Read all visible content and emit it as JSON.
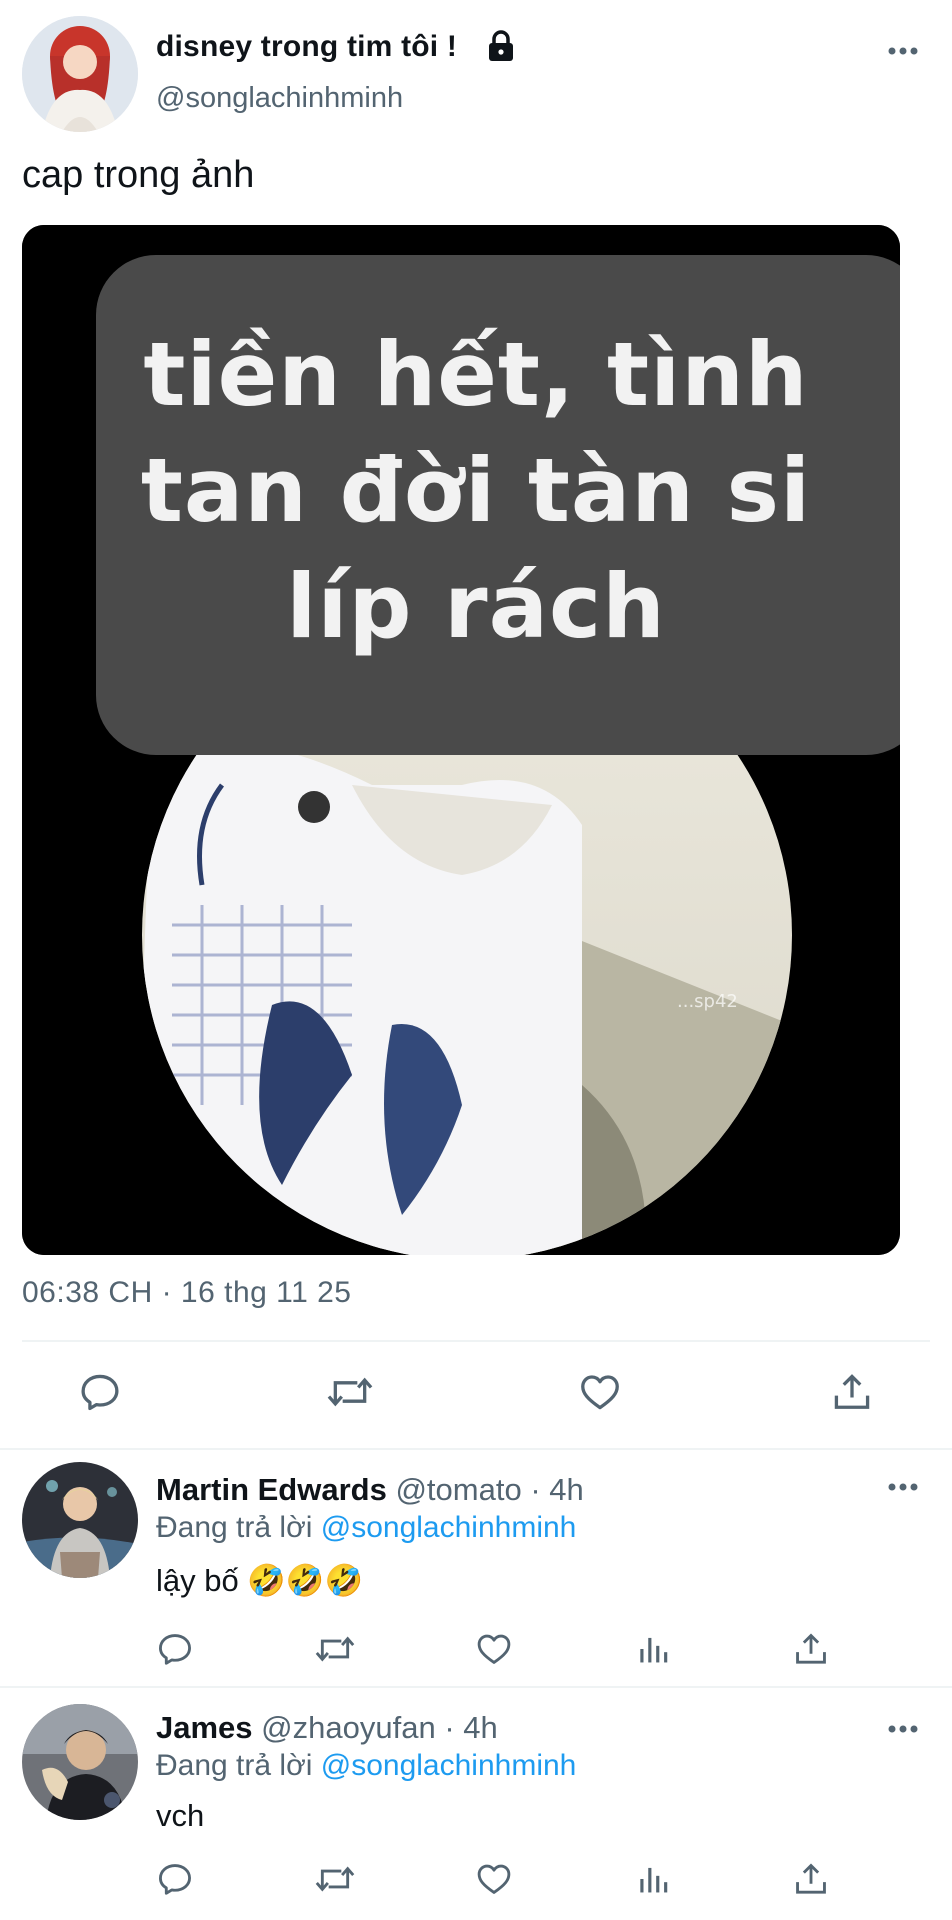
{
  "main_tweet": {
    "author_name": "disney trong tim tôi !",
    "author_handle": "@songlachinhminh",
    "text": "cap trong ảnh",
    "image_caption": "tiền hết, tình\ntan đời tàn si\nlíp rách",
    "image_watermark": "...sp42",
    "timestamp": "06:38 CH · 16 thg 11 25",
    "actions": [
      "reply-icon",
      "retweet-icon",
      "like-icon",
      "share-icon"
    ]
  },
  "replies": [
    {
      "name": "Martin Edwards",
      "handle": "@tomato",
      "time": "4h",
      "replying_prefix": "Đang trả lời",
      "replying_to": "@songlachinhminh",
      "text": "lậy bố 🤣🤣🤣"
    },
    {
      "name": "James",
      "handle": "@zhaoyufan",
      "time": "4h",
      "replying_prefix": "Đang trả lời",
      "replying_to": "@songlachinhminh",
      "text": "vch"
    }
  ],
  "colors": {
    "text_primary": "#0f1419",
    "text_secondary": "#536471",
    "link": "#1d9bf0",
    "divider": "#eff3f4"
  }
}
